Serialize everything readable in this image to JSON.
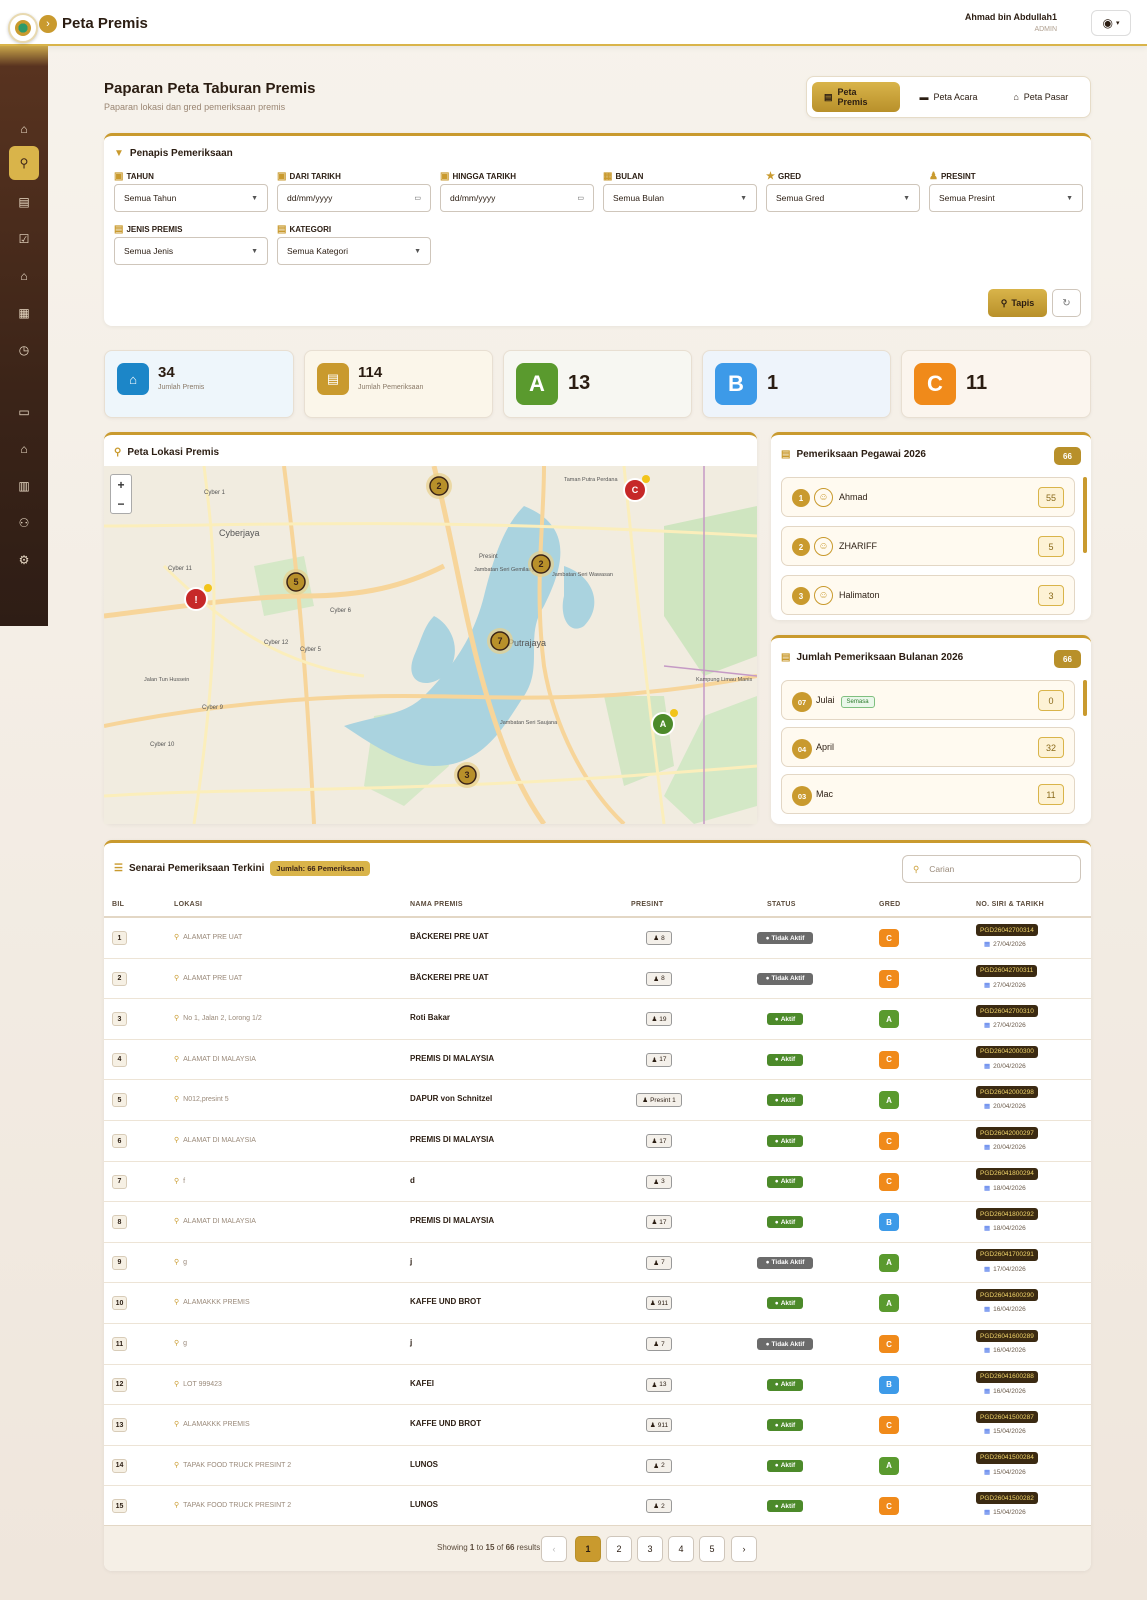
{
  "header": {
    "title": "Peta Premis",
    "user_name": "Ahmad bin Abdullah1",
    "user_role": "ADMIN"
  },
  "page": {
    "title": "Paparan Peta Taburan Premis",
    "subtitle": "Paparan lokasi dan gred pemeriksaan premis"
  },
  "tabs": [
    {
      "label": "Peta Premis",
      "icon": "building-icon"
    },
    {
      "label": "Peta Acara",
      "icon": "calendar-icon"
    },
    {
      "label": "Peta Pasar",
      "icon": "store-icon"
    }
  ],
  "filter": {
    "title": "Penapis Pemeriksaan",
    "fields": [
      {
        "label": "TAHUN",
        "value": "Semua Tahun",
        "type": "select"
      },
      {
        "label": "DARI TARIKH",
        "value": "dd/mm/yyyy",
        "type": "date"
      },
      {
        "label": "HINGGA TARIKH",
        "value": "dd/mm/yyyy",
        "type": "date"
      },
      {
        "label": "BULAN",
        "value": "Semua Bulan",
        "type": "select"
      },
      {
        "label": "GRED",
        "value": "Semua Gred",
        "type": "select"
      },
      {
        "label": "PRESINT",
        "value": "Semua Presint",
        "type": "select"
      },
      {
        "label": "JENIS PREMIS",
        "value": "Semua Jenis",
        "type": "select"
      },
      {
        "label": "KATEGORI",
        "value": "Semua Kategori",
        "type": "select"
      }
    ],
    "apply_label": "Tapis"
  },
  "stats": [
    {
      "value": "34",
      "label": "Jumlah Premis"
    },
    {
      "value": "114",
      "label": "Jumlah Pemeriksaan"
    },
    {
      "grade": "A",
      "value": "13"
    },
    {
      "grade": "B",
      "value": "1"
    },
    {
      "grade": "C",
      "value": "11"
    }
  ],
  "map": {
    "title": "Peta Lokasi Premis",
    "zoom_in": "+",
    "zoom_out": "−",
    "labels": [
      "Cyberjaya",
      "Cyber 1",
      "Cyber 11",
      "Cyber 6",
      "Cyber 5",
      "Cyber 12",
      "Cyber 9",
      "Cyber 10",
      "Presint",
      "Jambatan Seri Wawasan",
      "Jambatan Seri Gemilang",
      "Jambatan Seri Saujana",
      "Kampung Limau Manis",
      "Taman Putra Perdana",
      "Jalan Tun Hussein",
      "Putrajaya"
    ],
    "markers": [
      {
        "label": "2",
        "kind": "cluster"
      },
      {
        "label": "C",
        "kind": "grade-C"
      },
      {
        "label": "2",
        "kind": "cluster"
      },
      {
        "label": "5",
        "kind": "cluster"
      },
      {
        "label": "!",
        "kind": "alert"
      },
      {
        "label": "7",
        "kind": "cluster"
      },
      {
        "label": "A",
        "kind": "grade-A"
      },
      {
        "label": "3",
        "kind": "cluster"
      }
    ]
  },
  "pegawai": {
    "title": "Pemeriksaan Pegawai 2026",
    "total": "66",
    "items": [
      {
        "rank": "1",
        "name": "Ahmad",
        "count": "55"
      },
      {
        "rank": "2",
        "name": "ZHARIFF",
        "count": "5"
      },
      {
        "rank": "3",
        "name": "Halimaton",
        "count": "3"
      }
    ]
  },
  "bulanan": {
    "title": "Jumlah Pemeriksaan Bulanan 2026",
    "total": "66",
    "current_tag": "Semasa",
    "items": [
      {
        "num": "07",
        "name": "Julai",
        "count": "0",
        "current": true
      },
      {
        "num": "04",
        "name": "April",
        "count": "32"
      },
      {
        "num": "03",
        "name": "Mac",
        "count": "11"
      }
    ]
  },
  "table": {
    "title": "Senarai Pemeriksaan Terkini",
    "count_badge": "Jumlah: 66 Pemeriksaan",
    "search_placeholder": "Carian",
    "headers": [
      "BIL",
      "LOKASI",
      "NAMA PREMIS",
      "PRESINT",
      "STATUS",
      "GRED",
      "NO. SIRI & TARIKH"
    ],
    "rows": [
      {
        "bil": "1",
        "lokasi": "ALAMAT PRE UAT",
        "nama": "BÄCKEREI PRE UAT",
        "presint": "8",
        "status": "Tidak Aktif",
        "gred": "C",
        "siri": "PGD26042700314",
        "tarikh": "27/04/2026"
      },
      {
        "bil": "2",
        "lokasi": "ALAMAT PRE UAT",
        "nama": "BÄCKEREI PRE UAT",
        "presint": "8",
        "status": "Tidak Aktif",
        "gred": "C",
        "siri": "PGD26042700311",
        "tarikh": "27/04/2026"
      },
      {
        "bil": "3",
        "lokasi": "No 1, Jalan 2, Lorong 1/2",
        "nama": "Roti Bakar",
        "presint": "19",
        "status": "Aktif",
        "gred": "A",
        "siri": "PGD26042700310",
        "tarikh": "27/04/2026"
      },
      {
        "bil": "4",
        "lokasi": "ALAMAT DI MALAYSIA",
        "nama": "PREMIS DI MALAYSIA",
        "presint": "17",
        "status": "Aktif",
        "gred": "C",
        "siri": "PGD26042000300",
        "tarikh": "20/04/2026"
      },
      {
        "bil": "5",
        "lokasi": "N012,presint 5",
        "nama": "DAPUR von Schnitzel",
        "presint": "Presint 1",
        "status": "Aktif",
        "gred": "A",
        "siri": "PGD26042000298",
        "tarikh": "20/04/2026"
      },
      {
        "bil": "6",
        "lokasi": "ALAMAT DI MALAYSIA",
        "nama": "PREMIS DI MALAYSIA",
        "presint": "17",
        "status": "Aktif",
        "gred": "C",
        "siri": "PGD26042000297",
        "tarikh": "20/04/2026"
      },
      {
        "bil": "7",
        "lokasi": "f",
        "nama": "d",
        "presint": "3",
        "status": "Aktif",
        "gred": "C",
        "siri": "PGD26041800294",
        "tarikh": "18/04/2026"
      },
      {
        "bil": "8",
        "lokasi": "ALAMAT DI MALAYSIA",
        "nama": "PREMIS DI MALAYSIA",
        "presint": "17",
        "status": "Aktif",
        "gred": "B",
        "siri": "PGD26041800292",
        "tarikh": "18/04/2026"
      },
      {
        "bil": "9",
        "lokasi": "g",
        "nama": "j",
        "presint": "7",
        "status": "Tidak Aktif",
        "gred": "A",
        "siri": "PGD26041700291",
        "tarikh": "17/04/2026"
      },
      {
        "bil": "10",
        "lokasi": "ALAMAKKK PREMIS",
        "nama": "KAFFE UND BROT",
        "presint": "911",
        "status": "Aktif",
        "gred": "A",
        "siri": "PGD26041600290",
        "tarikh": "16/04/2026"
      },
      {
        "bil": "11",
        "lokasi": "g",
        "nama": "j",
        "presint": "7",
        "status": "Tidak Aktif",
        "gred": "C",
        "siri": "PGD26041600289",
        "tarikh": "16/04/2026"
      },
      {
        "bil": "12",
        "lokasi": "LOT 999423",
        "nama": "KAFEI",
        "presint": "13",
        "status": "Aktif",
        "gred": "B",
        "siri": "PGD26041600288",
        "tarikh": "16/04/2026"
      },
      {
        "bil": "13",
        "lokasi": "ALAMAKKK PREMIS",
        "nama": "KAFFE UND BROT",
        "presint": "911",
        "status": "Aktif",
        "gred": "C",
        "siri": "PGD26041500287",
        "tarikh": "15/04/2026"
      },
      {
        "bil": "14",
        "lokasi": "TAPAK FOOD TRUCK PRESINT 2",
        "nama": "LUNOS",
        "presint": "2",
        "status": "Aktif",
        "gred": "A",
        "siri": "PGD26041500284",
        "tarikh": "15/04/2026"
      },
      {
        "bil": "15",
        "lokasi": "TAPAK FOOD TRUCK PRESINT 2",
        "nama": "LUNOS",
        "presint": "2",
        "status": "Aktif",
        "gred": "C",
        "siri": "PGD26041500282",
        "tarikh": "15/04/2026"
      }
    ]
  },
  "pagination": {
    "showing_prefix": "Showing",
    "from": "1",
    "to_word": "to",
    "to": "15",
    "of_word": "of",
    "total": "66",
    "suffix": "results",
    "prev": "‹",
    "next": "›",
    "pages": [
      "1",
      "2",
      "3",
      "4",
      "5"
    ],
    "current": "1"
  },
  "colors": {
    "accent": "#c99a2e",
    "sidebar": "#3b2418",
    "grade_A": "#5a9a2e",
    "grade_B": "#3d9ae8",
    "grade_C": "#f08a1a"
  }
}
